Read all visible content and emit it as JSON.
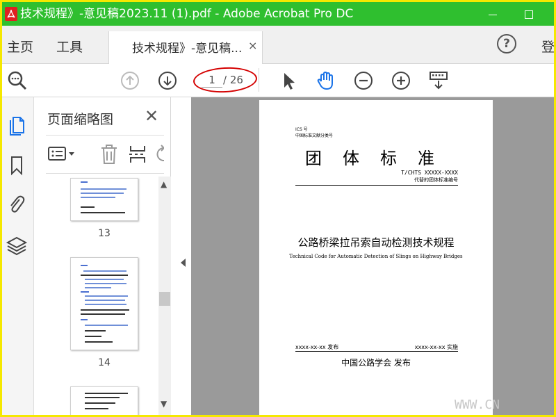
{
  "window": {
    "title": "技术规程》-意见稿2023.11 (1).pdf - Adobe Acrobat Pro DC",
    "app_icon": "acrobat-icon",
    "accent_color": "#2fbf2f"
  },
  "tabbar": {
    "home_label": "主页",
    "tools_label": "工具",
    "doc_tab_label": "技术规程》-意见稿...",
    "doc_tab_close": "×",
    "help_label": "?",
    "signin_label": "登"
  },
  "toolbar": {
    "current_page": "1",
    "total_pages": "/ 26",
    "icons": [
      "search-zoom-icon",
      "page-up-icon",
      "page-down-icon",
      "select-arrow-icon",
      "hand-icon",
      "zoom-out-icon",
      "zoom-in-icon",
      "keyboard-icon"
    ]
  },
  "thumbnail_panel": {
    "title": "页面缩略图",
    "close": "✕",
    "thumbs": [
      {
        "label": "13"
      },
      {
        "label": "14"
      }
    ]
  },
  "scroll": {
    "up": "▲",
    "down": "▼"
  },
  "document": {
    "ics": "ICS 号",
    "class_code": "中国标准文献分类号",
    "standard_title": "团体标准",
    "standard_no": "T/CHTS XXXXX-XXXX",
    "replaced_no": "代替的团体标准编号",
    "cn_title": "公路桥梁拉吊索自动检测技术规程",
    "en_title": "Technical Code for Automatic Detection of Slings on Highway Bridges",
    "publish_date": "xxxx-xx-xx 发布",
    "implement_date": "xxxx-xx-xx 实施",
    "publisher": "中国公路学会  发布"
  },
  "watermark": "WWW.CN"
}
